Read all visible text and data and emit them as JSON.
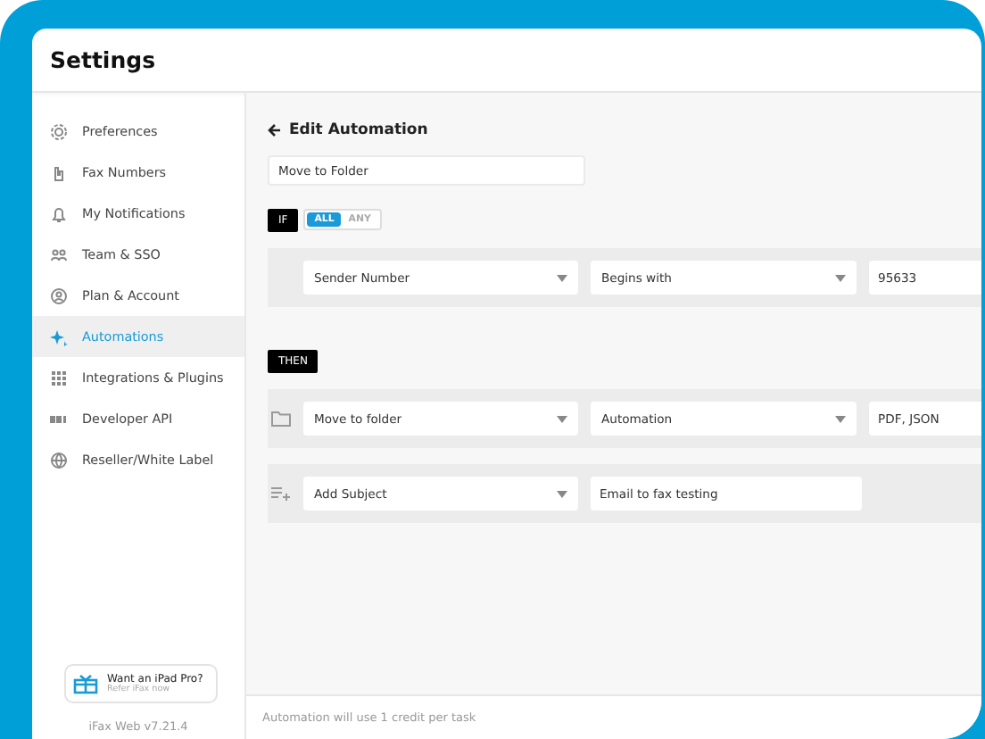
{
  "window": {
    "title": "Settings"
  },
  "sidebar": {
    "items": [
      {
        "label": "Preferences",
        "selected": false
      },
      {
        "label": "Fax Numbers",
        "selected": false
      },
      {
        "label": "My Notifications",
        "selected": false
      },
      {
        "label": "Team & SSO",
        "selected": false
      },
      {
        "label": "Plan & Account",
        "selected": false
      },
      {
        "label": "Automations",
        "selected": true
      },
      {
        "label": "Integrations & Plugins",
        "selected": false
      },
      {
        "label": "Developer API",
        "selected": false
      },
      {
        "label": "Reseller/White Label",
        "selected": false
      }
    ],
    "promo": {
      "title": "Want an iPad Pro?",
      "subtitle": "Refer iFax now"
    },
    "version": "iFax Web v7.21.4"
  },
  "editor": {
    "title": "Edit Automation",
    "name_value": "Move to Folder",
    "if_label": "IF",
    "match_options": [
      {
        "label": "ALL",
        "selected": true
      },
      {
        "label": "ANY",
        "selected": false
      }
    ],
    "conditions": [
      {
        "fields": [
          {
            "kind": "dropdown",
            "value": "Sender Number"
          },
          {
            "kind": "dropdown",
            "value": "Begins with"
          },
          {
            "kind": "input",
            "value": "95633"
          }
        ]
      }
    ],
    "then_label": "THEN",
    "actions": [
      {
        "fields": [
          {
            "kind": "dropdown",
            "value": "Move to folder"
          },
          {
            "kind": "dropdown",
            "value": "Automation"
          },
          {
            "kind": "input",
            "value": "PDF, JSON"
          }
        ]
      },
      {
        "fields": [
          {
            "kind": "dropdown",
            "value": "Add Subject"
          },
          {
            "kind": "input",
            "value": "Email to fax testing"
          }
        ]
      }
    ]
  },
  "footer": "Automation will use 1 credit per task"
}
